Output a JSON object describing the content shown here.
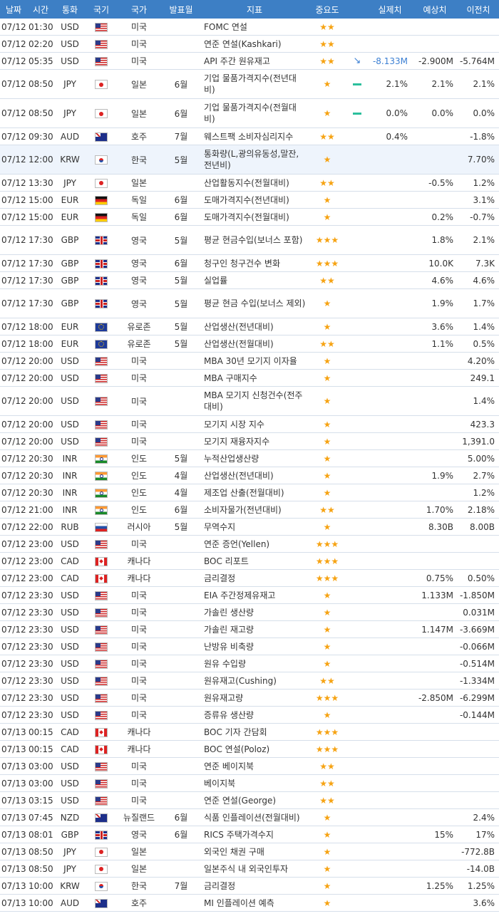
{
  "headers": [
    "날짜",
    "시간",
    "통화",
    "국기",
    "국가",
    "발표월",
    "지표",
    "중요도",
    "",
    "실제치",
    "예상치",
    "이전치"
  ],
  "rows": [
    {
      "date": "07/12",
      "time": "01:30",
      "cur": "USD",
      "flag": "us",
      "country": "미국",
      "period": "",
      "indicator": "FOMC 연설",
      "stars": "★★",
      "trend": "",
      "actual": "",
      "forecast": "",
      "previous": ""
    },
    {
      "date": "07/12",
      "time": "02:20",
      "cur": "USD",
      "flag": "us",
      "country": "미국",
      "period": "",
      "indicator": "연준 연설(Kashkari)",
      "stars": "★★",
      "trend": "",
      "actual": "",
      "forecast": "",
      "previous": ""
    },
    {
      "date": "07/12",
      "time": "05:35",
      "cur": "USD",
      "flag": "us",
      "country": "미국",
      "period": "",
      "indicator": "API 주간 원유재고",
      "stars": "★★",
      "trend": "down",
      "actual": "-8.133M",
      "forecast": "-2.900M",
      "previous": "-5.764M"
    },
    {
      "date": "07/12",
      "time": "08:50",
      "cur": "JPY",
      "flag": "jp",
      "country": "일본",
      "period": "6월",
      "indicator": "기업 물품가격지수(전년대비)",
      "stars": "★",
      "trend": "flat",
      "actual": "2.1%",
      "forecast": "2.1%",
      "previous": "2.1%",
      "tall": true
    },
    {
      "date": "07/12",
      "time": "08:50",
      "cur": "JPY",
      "flag": "jp",
      "country": "일본",
      "period": "6월",
      "indicator": "기업 물품가격지수(전월대비)",
      "stars": "★",
      "trend": "flat",
      "actual": "0.0%",
      "forecast": "0.0%",
      "previous": "0.0%",
      "tall": true
    },
    {
      "date": "07/12",
      "time": "09:30",
      "cur": "AUD",
      "flag": "au",
      "country": "호주",
      "period": "7월",
      "indicator": "웨스트팩 소비자심리지수",
      "stars": "★★",
      "trend": "",
      "actual": "0.4%",
      "forecast": "",
      "previous": "-1.8%"
    },
    {
      "date": "07/12",
      "time": "12:00",
      "cur": "KRW",
      "flag": "kr",
      "country": "한국",
      "period": "5월",
      "indicator": "통화량(L,광의유동성,말잔,전년비)",
      "stars": "★",
      "trend": "",
      "actual": "",
      "forecast": "",
      "previous": "7.70%",
      "tall": true,
      "hl": true
    },
    {
      "date": "07/12",
      "time": "13:30",
      "cur": "JPY",
      "flag": "jp",
      "country": "일본",
      "period": "",
      "indicator": "산업활동지수(전월대비)",
      "stars": "★★",
      "trend": "",
      "actual": "",
      "forecast": "-0.5%",
      "previous": "1.2%"
    },
    {
      "date": "07/12",
      "time": "15:00",
      "cur": "EUR",
      "flag": "de",
      "country": "독일",
      "period": "6월",
      "indicator": "도매가격지수(전년대비)",
      "stars": "★",
      "trend": "",
      "actual": "",
      "forecast": "",
      "previous": "3.1%"
    },
    {
      "date": "07/12",
      "time": "15:00",
      "cur": "EUR",
      "flag": "de",
      "country": "독일",
      "period": "6월",
      "indicator": "도매가격지수(전월대비)",
      "stars": "★",
      "trend": "",
      "actual": "",
      "forecast": "0.2%",
      "previous": "-0.7%"
    },
    {
      "date": "07/12",
      "time": "17:30",
      "cur": "GBP",
      "flag": "gb",
      "country": "영국",
      "period": "5월",
      "indicator": "평균 현금수입(보너스 포함)",
      "stars": "★★★",
      "trend": "",
      "actual": "",
      "forecast": "1.8%",
      "previous": "2.1%",
      "tall": true
    },
    {
      "date": "07/12",
      "time": "17:30",
      "cur": "GBP",
      "flag": "gb",
      "country": "영국",
      "period": "6월",
      "indicator": "청구인 청구건수 변화",
      "stars": "★★★",
      "trend": "",
      "actual": "",
      "forecast": "10.0K",
      "previous": "7.3K"
    },
    {
      "date": "07/12",
      "time": "17:30",
      "cur": "GBP",
      "flag": "gb",
      "country": "영국",
      "period": "5월",
      "indicator": "실업률",
      "stars": "★★",
      "trend": "",
      "actual": "",
      "forecast": "4.6%",
      "previous": "4.6%"
    },
    {
      "date": "07/12",
      "time": "17:30",
      "cur": "GBP",
      "flag": "gb",
      "country": "영국",
      "period": "5월",
      "indicator": "평균 현금 수입(보너스 제외)",
      "stars": "★",
      "trend": "",
      "actual": "",
      "forecast": "1.9%",
      "previous": "1.7%",
      "tall": true
    },
    {
      "date": "07/12",
      "time": "18:00",
      "cur": "EUR",
      "flag": "eu",
      "country": "유로존",
      "period": "5월",
      "indicator": "산업생산(전년대비)",
      "stars": "★",
      "trend": "",
      "actual": "",
      "forecast": "3.6%",
      "previous": "1.4%"
    },
    {
      "date": "07/12",
      "time": "18:00",
      "cur": "EUR",
      "flag": "eu",
      "country": "유로존",
      "period": "5월",
      "indicator": "산업생산(전월대비)",
      "stars": "★★",
      "trend": "",
      "actual": "",
      "forecast": "1.1%",
      "previous": "0.5%"
    },
    {
      "date": "07/12",
      "time": "20:00",
      "cur": "USD",
      "flag": "us",
      "country": "미국",
      "period": "",
      "indicator": "MBA 30년 모기지 이자율",
      "stars": "★",
      "trend": "",
      "actual": "",
      "forecast": "",
      "previous": "4.20%"
    },
    {
      "date": "07/12",
      "time": "20:00",
      "cur": "USD",
      "flag": "us",
      "country": "미국",
      "period": "",
      "indicator": "MBA 구매지수",
      "stars": "★",
      "trend": "",
      "actual": "",
      "forecast": "",
      "previous": "249.1"
    },
    {
      "date": "07/12",
      "time": "20:00",
      "cur": "USD",
      "flag": "us",
      "country": "미국",
      "period": "",
      "indicator": "MBA 모기지 신청건수(전주대비)",
      "stars": "★",
      "trend": "",
      "actual": "",
      "forecast": "",
      "previous": "1.4%",
      "tall": true
    },
    {
      "date": "07/12",
      "time": "20:00",
      "cur": "USD",
      "flag": "us",
      "country": "미국",
      "period": "",
      "indicator": "모기지 시장 지수",
      "stars": "★",
      "trend": "",
      "actual": "",
      "forecast": "",
      "previous": "423.3"
    },
    {
      "date": "07/12",
      "time": "20:00",
      "cur": "USD",
      "flag": "us",
      "country": "미국",
      "period": "",
      "indicator": "모기지 재융자지수",
      "stars": "★",
      "trend": "",
      "actual": "",
      "forecast": "",
      "previous": "1,391.0"
    },
    {
      "date": "07/12",
      "time": "20:30",
      "cur": "INR",
      "flag": "in",
      "country": "인도",
      "period": "5월",
      "indicator": "누적산업생산량",
      "stars": "★",
      "trend": "",
      "actual": "",
      "forecast": "",
      "previous": "5.00%"
    },
    {
      "date": "07/12",
      "time": "20:30",
      "cur": "INR",
      "flag": "in",
      "country": "인도",
      "period": "4월",
      "indicator": "산업생산(전년대비)",
      "stars": "★",
      "trend": "",
      "actual": "",
      "forecast": "1.9%",
      "previous": "2.7%"
    },
    {
      "date": "07/12",
      "time": "20:30",
      "cur": "INR",
      "flag": "in",
      "country": "인도",
      "period": "4월",
      "indicator": "제조업 산출(전월대비)",
      "stars": "★",
      "trend": "",
      "actual": "",
      "forecast": "",
      "previous": "1.2%"
    },
    {
      "date": "07/12",
      "time": "21:00",
      "cur": "INR",
      "flag": "in",
      "country": "인도",
      "period": "6월",
      "indicator": "소비자물가(전년대비)",
      "stars": "★★",
      "trend": "",
      "actual": "",
      "forecast": "1.70%",
      "previous": "2.18%"
    },
    {
      "date": "07/12",
      "time": "22:00",
      "cur": "RUB",
      "flag": "ru",
      "country": "러시아",
      "period": "5월",
      "indicator": "무역수지",
      "stars": "★",
      "trend": "",
      "actual": "",
      "forecast": "8.30B",
      "previous": "8.00B"
    },
    {
      "date": "07/12",
      "time": "23:00",
      "cur": "USD",
      "flag": "us",
      "country": "미국",
      "period": "",
      "indicator": "연준 증언(Yellen)",
      "stars": "★★★",
      "trend": "",
      "actual": "",
      "forecast": "",
      "previous": ""
    },
    {
      "date": "07/12",
      "time": "23:00",
      "cur": "CAD",
      "flag": "ca",
      "country": "캐나다",
      "period": "",
      "indicator": "BOC 리포트",
      "stars": "★★★",
      "trend": "",
      "actual": "",
      "forecast": "",
      "previous": ""
    },
    {
      "date": "07/12",
      "time": "23:00",
      "cur": "CAD",
      "flag": "ca",
      "country": "캐나다",
      "period": "",
      "indicator": "금리결정",
      "stars": "★★★",
      "trend": "",
      "actual": "",
      "forecast": "0.75%",
      "previous": "0.50%"
    },
    {
      "date": "07/12",
      "time": "23:30",
      "cur": "USD",
      "flag": "us",
      "country": "미국",
      "period": "",
      "indicator": "EIA 주간정제유재고",
      "stars": "★",
      "trend": "",
      "actual": "",
      "forecast": "1.133M",
      "previous": "-1.850M"
    },
    {
      "date": "07/12",
      "time": "23:30",
      "cur": "USD",
      "flag": "us",
      "country": "미국",
      "period": "",
      "indicator": "가솔린 생산량",
      "stars": "★",
      "trend": "",
      "actual": "",
      "forecast": "",
      "previous": "0.031M"
    },
    {
      "date": "07/12",
      "time": "23:30",
      "cur": "USD",
      "flag": "us",
      "country": "미국",
      "period": "",
      "indicator": "가솔린 재고량",
      "stars": "★",
      "trend": "",
      "actual": "",
      "forecast": "1.147M",
      "previous": "-3.669M"
    },
    {
      "date": "07/12",
      "time": "23:30",
      "cur": "USD",
      "flag": "us",
      "country": "미국",
      "period": "",
      "indicator": "난방유 비축량",
      "stars": "★",
      "trend": "",
      "actual": "",
      "forecast": "",
      "previous": "-0.066M"
    },
    {
      "date": "07/12",
      "time": "23:30",
      "cur": "USD",
      "flag": "us",
      "country": "미국",
      "period": "",
      "indicator": "원유 수입량",
      "stars": "★",
      "trend": "",
      "actual": "",
      "forecast": "",
      "previous": "-0.514M"
    },
    {
      "date": "07/12",
      "time": "23:30",
      "cur": "USD",
      "flag": "us",
      "country": "미국",
      "period": "",
      "indicator": "원유재고(Cushing)",
      "stars": "★★",
      "trend": "",
      "actual": "",
      "forecast": "",
      "previous": "-1.334M"
    },
    {
      "date": "07/12",
      "time": "23:30",
      "cur": "USD",
      "flag": "us",
      "country": "미국",
      "period": "",
      "indicator": "원유재고량",
      "stars": "★★★",
      "trend": "",
      "actual": "",
      "forecast": "-2.850M",
      "previous": "-6.299M"
    },
    {
      "date": "07/12",
      "time": "23:30",
      "cur": "USD",
      "flag": "us",
      "country": "미국",
      "period": "",
      "indicator": "증류유 생산량",
      "stars": "★",
      "trend": "",
      "actual": "",
      "forecast": "",
      "previous": "-0.144M"
    },
    {
      "date": "07/13",
      "time": "00:15",
      "cur": "CAD",
      "flag": "ca",
      "country": "캐나다",
      "period": "",
      "indicator": "BOC 기자 간담회",
      "stars": "★★★",
      "trend": "",
      "actual": "",
      "forecast": "",
      "previous": ""
    },
    {
      "date": "07/13",
      "time": "00:15",
      "cur": "CAD",
      "flag": "ca",
      "country": "캐나다",
      "period": "",
      "indicator": "BOC 연설(Poloz)",
      "stars": "★★★",
      "trend": "",
      "actual": "",
      "forecast": "",
      "previous": ""
    },
    {
      "date": "07/13",
      "time": "03:00",
      "cur": "USD",
      "flag": "us",
      "country": "미국",
      "period": "",
      "indicator": "연준 베이지북",
      "stars": "★★",
      "trend": "",
      "actual": "",
      "forecast": "",
      "previous": ""
    },
    {
      "date": "07/13",
      "time": "03:00",
      "cur": "USD",
      "flag": "us",
      "country": "미국",
      "period": "",
      "indicator": "베이지북",
      "stars": "★★",
      "trend": "",
      "actual": "",
      "forecast": "",
      "previous": ""
    },
    {
      "date": "07/13",
      "time": "03:15",
      "cur": "USD",
      "flag": "us",
      "country": "미국",
      "period": "",
      "indicator": "연준 연설(George)",
      "stars": "★★",
      "trend": "",
      "actual": "",
      "forecast": "",
      "previous": ""
    },
    {
      "date": "07/13",
      "time": "07:45",
      "cur": "NZD",
      "flag": "nz",
      "country": "뉴질랜드",
      "period": "6월",
      "indicator": "식품 인플레이션(전월대비)",
      "stars": "★",
      "trend": "",
      "actual": "",
      "forecast": "",
      "previous": "2.4%"
    },
    {
      "date": "07/13",
      "time": "08:01",
      "cur": "GBP",
      "flag": "gb",
      "country": "영국",
      "period": "6월",
      "indicator": "RICS 주택가격수지",
      "stars": "★",
      "trend": "",
      "actual": "",
      "forecast": "15%",
      "previous": "17%"
    },
    {
      "date": "07/13",
      "time": "08:50",
      "cur": "JPY",
      "flag": "jp",
      "country": "일본",
      "period": "",
      "indicator": "외국인 채권 구매",
      "stars": "★",
      "trend": "",
      "actual": "",
      "forecast": "",
      "previous": "-772.8B"
    },
    {
      "date": "07/13",
      "time": "08:50",
      "cur": "JPY",
      "flag": "jp",
      "country": "일본",
      "period": "",
      "indicator": "일본주식 내 외국인투자",
      "stars": "★",
      "trend": "",
      "actual": "",
      "forecast": "",
      "previous": "-14.0B"
    },
    {
      "date": "07/13",
      "time": "10:00",
      "cur": "KRW",
      "flag": "kr",
      "country": "한국",
      "period": "7월",
      "indicator": "금리결정",
      "stars": "★",
      "trend": "",
      "actual": "",
      "forecast": "1.25%",
      "previous": "1.25%"
    },
    {
      "date": "07/13",
      "time": "10:00",
      "cur": "AUD",
      "flag": "au",
      "country": "호주",
      "period": "",
      "indicator": "MI 인플레이션 예측",
      "stars": "★",
      "trend": "",
      "actual": "",
      "forecast": "",
      "previous": "3.6%"
    }
  ]
}
